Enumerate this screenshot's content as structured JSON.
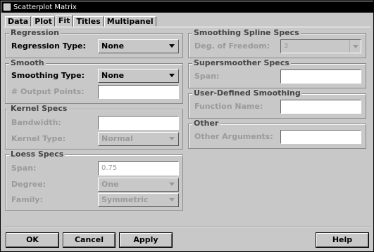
{
  "window": {
    "title": "Scatterplot Matrix"
  },
  "tabs": [
    {
      "label": "Data"
    },
    {
      "label": "Plot"
    },
    {
      "label": "Fit"
    },
    {
      "label": "Titles"
    },
    {
      "label": "Multipanel"
    }
  ],
  "regression": {
    "legend": "Regression",
    "type_label": "Regression Type:",
    "type_value": "None"
  },
  "smooth": {
    "legend": "Smooth",
    "type_label": "Smoothing Type:",
    "type_value": "None",
    "output_points_label": "# Output Points:",
    "output_points_value": ""
  },
  "kernel": {
    "legend": "Kernel Specs",
    "bandwidth_label": "Bandwidth:",
    "bandwidth_value": "",
    "type_label": "Kernel Type:",
    "type_value": "Normal"
  },
  "loess": {
    "legend": "Loess Specs",
    "span_label": "Span:",
    "span_value": "0.75",
    "degree_label": "Degree:",
    "degree_value": "One",
    "family_label": "Family:",
    "family_value": "Symmetric"
  },
  "spline": {
    "legend": "Smoothing Spline Specs",
    "dof_label": "Deg. of Freedom:",
    "dof_value": "3"
  },
  "supersmoother": {
    "legend": "Supersmoother Specs",
    "span_label": "Span:",
    "span_value": ""
  },
  "user_defined": {
    "legend": "User-Defined Smoothing",
    "function_label": "Function Name:",
    "function_value": ""
  },
  "other": {
    "legend": "Other",
    "args_label": "Other Arguments:",
    "args_value": ""
  },
  "buttons": {
    "ok": "OK",
    "cancel": "Cancel",
    "apply": "Apply",
    "help": "Help"
  }
}
